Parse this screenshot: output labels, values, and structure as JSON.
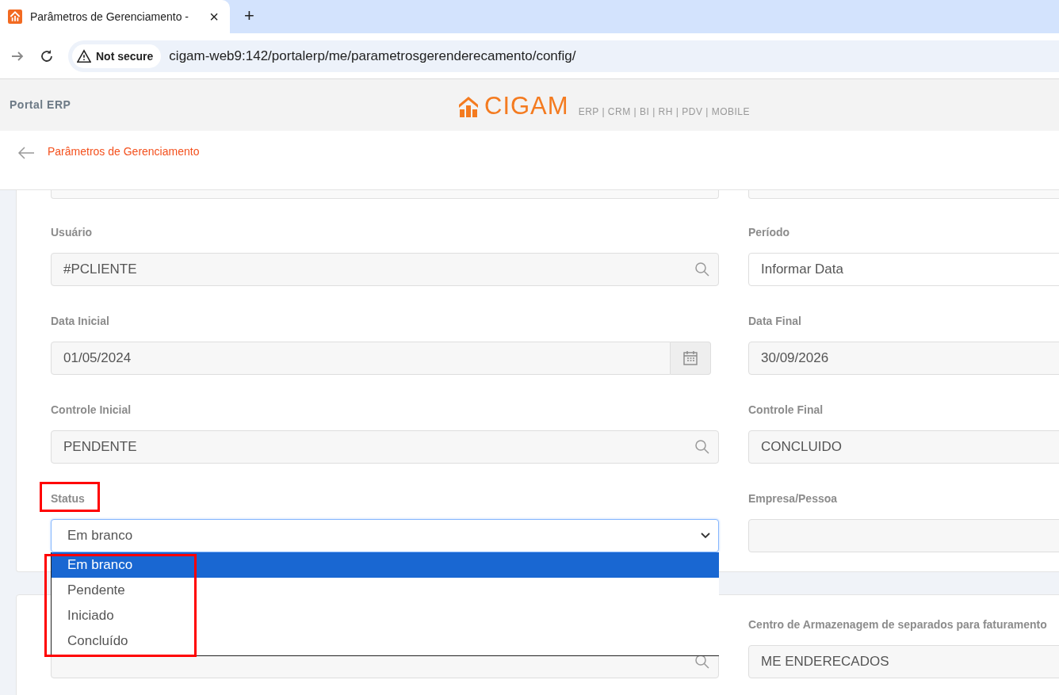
{
  "browser": {
    "tab_title": "Parâmetros de Gerenciamento -",
    "new_tab": "+",
    "close": "×",
    "security": "Not secure",
    "url": "cigam-web9:142/portalerp/me/parametrosgerenderecamento/config/"
  },
  "header": {
    "title": "Portal ERP",
    "logo": "CIGAM",
    "products": "ERP | CRM | BI | RH | PDV | MOBILE"
  },
  "breadcrumb": {
    "title": "Parâmetros de Gerenciamento"
  },
  "form": {
    "fields": [
      {
        "label": "Usuário",
        "value": "#PCLIENTE",
        "kind": "search"
      },
      {
        "label": "Período",
        "value": "Informar Data",
        "kind": "select"
      },
      {
        "label": "Data Inicial",
        "value": "01/05/2024",
        "kind": "date"
      },
      {
        "label": "Data Final",
        "value": "30/09/2026",
        "kind": "text"
      },
      {
        "label": "Controle Inicial",
        "value": "PENDENTE",
        "kind": "search"
      },
      {
        "label": "Controle Final",
        "value": "CONCLUIDO",
        "kind": "text"
      },
      {
        "label": "Status",
        "value": "Em branco",
        "kind": "select",
        "highlighted": true
      },
      {
        "label": "Empresa/Pessoa",
        "kind": "text"
      }
    ]
  },
  "status_dropdown": {
    "highlighted": true,
    "options": [
      {
        "label": "Em branco",
        "selected": true
      },
      {
        "label": "Pendente",
        "selected": false
      },
      {
        "label": "Iniciado",
        "selected": false
      },
      {
        "label": "Concluído",
        "selected": false
      }
    ]
  },
  "second_form": {
    "fields": [
      {
        "kind": "search"
      },
      {
        "label": "Centro de Armazenagem de separados para faturamento",
        "value": "ME ENDERECADOS",
        "kind": "text"
      }
    ]
  }
}
